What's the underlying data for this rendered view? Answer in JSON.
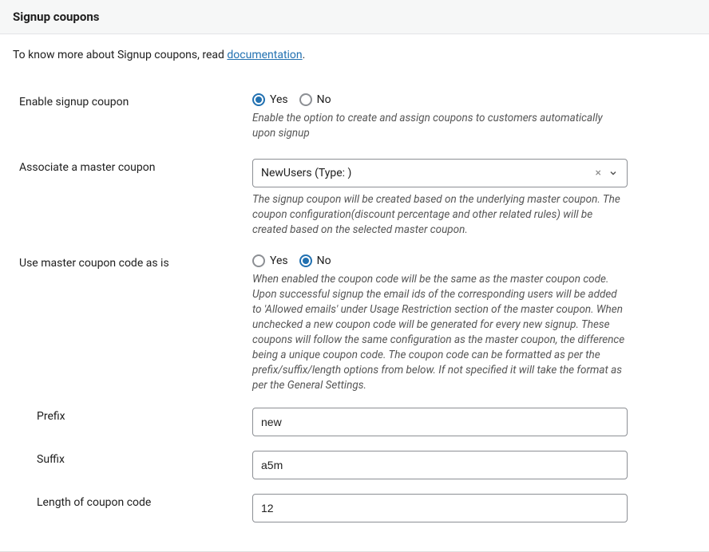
{
  "header": {
    "title": "Signup coupons"
  },
  "intro": {
    "prefix": "To know more about Signup coupons, read ",
    "link_text": "documentation",
    "suffix": "."
  },
  "fields": {
    "enable": {
      "label": "Enable signup coupon",
      "yes": "Yes",
      "no": "No",
      "description": "Enable the option to create and assign coupons to customers automatically upon signup"
    },
    "associate": {
      "label": "Associate a master coupon",
      "value": "NewUsers (Type: )",
      "description": "The signup coupon will be created based on the underlying master coupon. The coupon configuration(discount percentage and other related rules) will be created based on the selected master coupon."
    },
    "use_master": {
      "label": "Use master coupon code as is",
      "yes": "Yes",
      "no": "No",
      "description": "When enabled the coupon code will be the same as the master coupon code. Upon successful signup the email ids of the corresponding users will be added to 'Allowed emails' under Usage Restriction section of the master coupon. When unchecked a new coupon code will be generated for every new signup. These coupons will follow the same configuration as the master coupon, the difference being a unique coupon code. The coupon code can be formatted as per the prefix/suffix/length options from below. If not specified it will take the format as per the General Settings."
    },
    "prefix": {
      "label": "Prefix",
      "value": "new"
    },
    "suffix": {
      "label": "Suffix",
      "value": "a5m"
    },
    "length": {
      "label": "Length of coupon code",
      "value": "12"
    }
  }
}
